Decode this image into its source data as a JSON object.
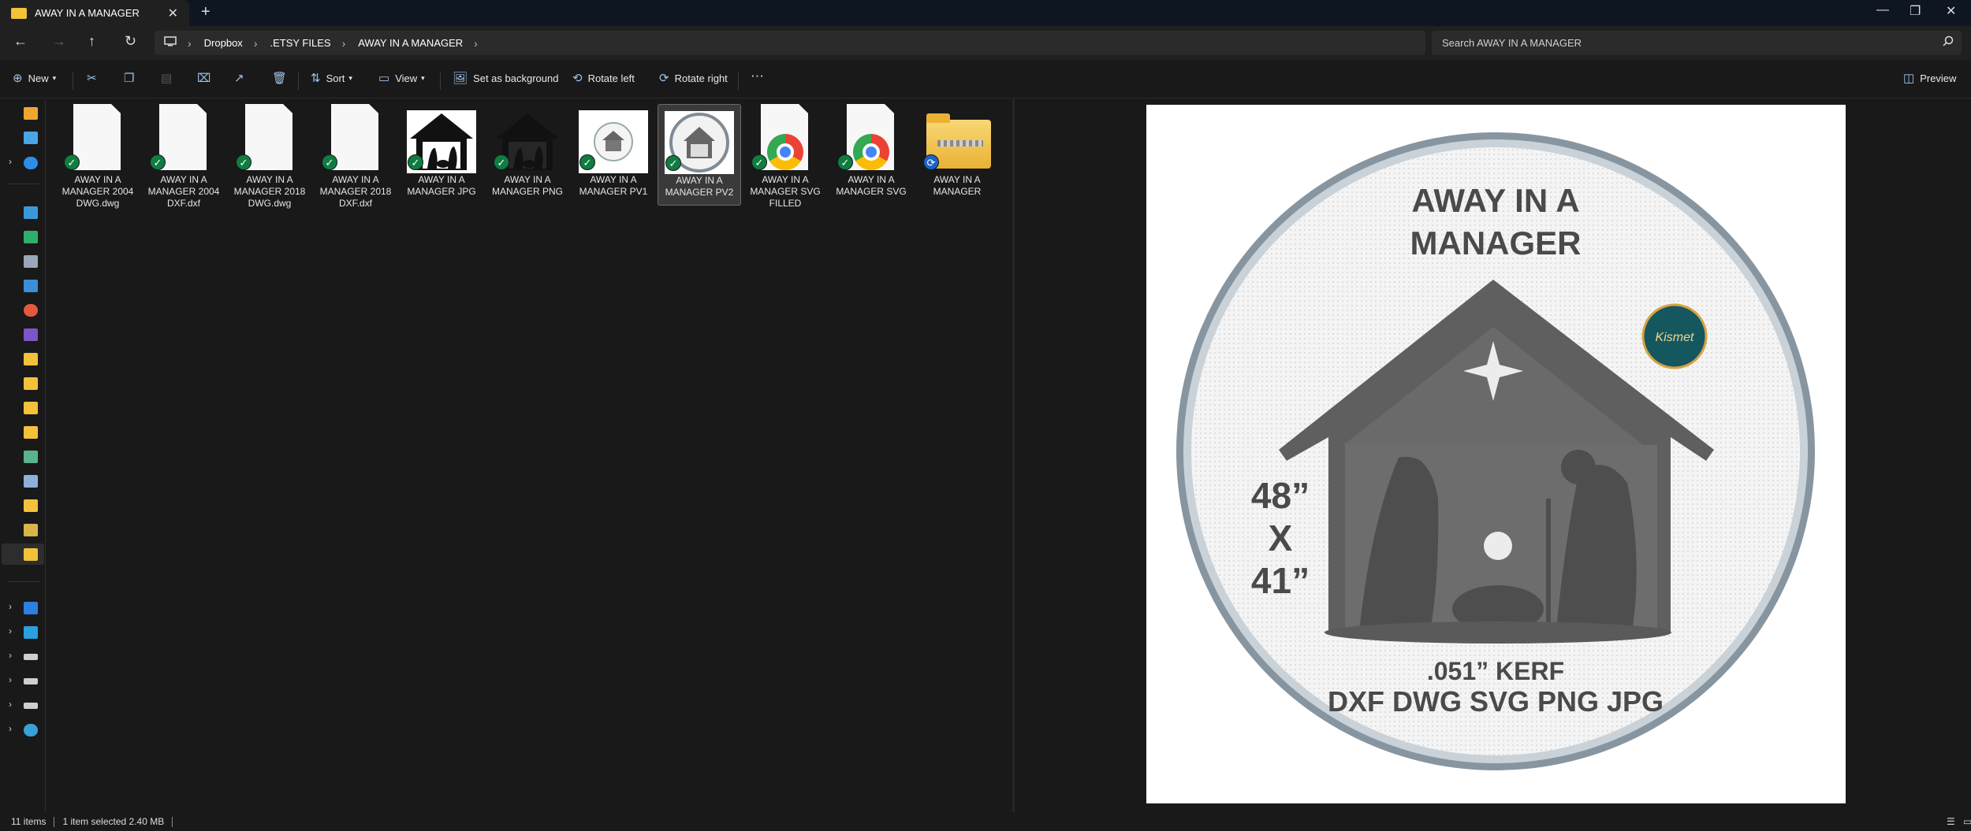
{
  "window": {
    "tab_title": "AWAY IN A MANAGER",
    "new_tab": "+",
    "close_tab": "✕",
    "minimize": "—",
    "maximize": "❐",
    "close": "✕"
  },
  "nav": {
    "back": "←",
    "forward": "→",
    "up": "↑",
    "refresh": "↻"
  },
  "breadcrumb": [
    "Dropbox",
    ".ETSY FILES",
    "AWAY IN A MANAGER"
  ],
  "search": {
    "placeholder": "Search AWAY IN A MANAGER"
  },
  "toolbar": {
    "new_label": "New",
    "sort_label": "Sort",
    "view_label": "View",
    "set_background_label": "Set as background",
    "rotate_left_label": "Rotate left",
    "rotate_right_label": "Rotate right",
    "more_label": "···",
    "preview_label": "Preview"
  },
  "files": [
    {
      "name": "AWAY IN A MANAGER 2004 DWG.dwg",
      "kind": "doc",
      "status": "synced"
    },
    {
      "name": "AWAY IN A MANAGER 2004 DXF.dxf",
      "kind": "doc",
      "status": "synced"
    },
    {
      "name": "AWAY IN A MANAGER 2018 DWG.dwg",
      "kind": "doc",
      "status": "synced"
    },
    {
      "name": "AWAY IN A MANAGER 2018 DXF.dxf",
      "kind": "doc",
      "status": "synced"
    },
    {
      "name": "AWAY IN A MANAGER JPG",
      "kind": "image-white",
      "status": "synced"
    },
    {
      "name": "AWAY IN A MANAGER PNG",
      "kind": "image-transparent",
      "status": "synced"
    },
    {
      "name": "AWAY IN A MANAGER PV1",
      "kind": "image-circle",
      "status": "synced"
    },
    {
      "name": "AWAY IN A MANAGER PV2",
      "kind": "image-circle-2",
      "status": "synced",
      "selected": true
    },
    {
      "name": "AWAY IN A MANAGER SVG FILLED",
      "kind": "chrome",
      "status": "synced"
    },
    {
      "name": "AWAY IN A MANAGER SVG",
      "kind": "chrome",
      "status": "synced"
    },
    {
      "name": "AWAY IN A MANAGER",
      "kind": "zip",
      "status": "syncing"
    }
  ],
  "preview": {
    "title_line1": "AWAY IN A",
    "title_line2": "MANAGER",
    "size_w": "48”",
    "size_x": "X",
    "size_h": "41”",
    "kerf": ".051” KERF",
    "formats": "DXF DWG SVG PNG JPG",
    "badge": "Kismet"
  },
  "status": {
    "count": "11 items",
    "selection": "1 item selected  2.40 MB"
  },
  "colors": {
    "accent": "#9fc3ea",
    "synced": "#107c41",
    "syncing": "#1a64c8",
    "folder": "#f3c13a"
  }
}
